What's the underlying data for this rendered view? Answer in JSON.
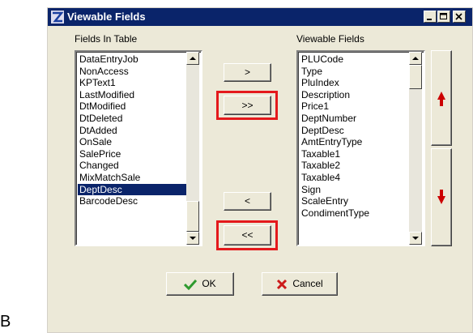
{
  "page_letter": "B",
  "window": {
    "title": "Viewable Fields"
  },
  "left_list": {
    "label": "Fields In Table",
    "items": [
      "DataEntryJob",
      "NonAccess",
      "KPText1",
      "LastModified",
      "DtModified",
      "DtDeleted",
      "DtAdded",
      "OnSale",
      "SalePrice",
      "Changed",
      "MixMatchSale",
      "DeptDesc",
      "BarcodeDesc"
    ],
    "selected": "DeptDesc"
  },
  "right_list": {
    "label": "Viewable Fields",
    "items": [
      "PLUCode",
      "Type",
      "PluIndex",
      "Description",
      "Price1",
      "DeptNumber",
      "DeptDesc",
      "AmtEntryType",
      "Taxable1",
      "Taxable2",
      "Taxable4",
      "Sign",
      "ScaleEntry",
      "CondimentType"
    ]
  },
  "buttons": {
    "add": ">",
    "add_all": ">>",
    "remove": "<",
    "remove_all": "<<",
    "ok": "OK",
    "cancel": "Cancel"
  },
  "colors": {
    "highlight": "#e4191c",
    "titlebar": "#0a246a",
    "arrow": "#cc0000"
  },
  "icons": {
    "move_up": "red-up-arrow-icon",
    "move_down": "red-down-arrow-icon",
    "ok": "green-check-icon",
    "cancel": "red-x-icon"
  }
}
